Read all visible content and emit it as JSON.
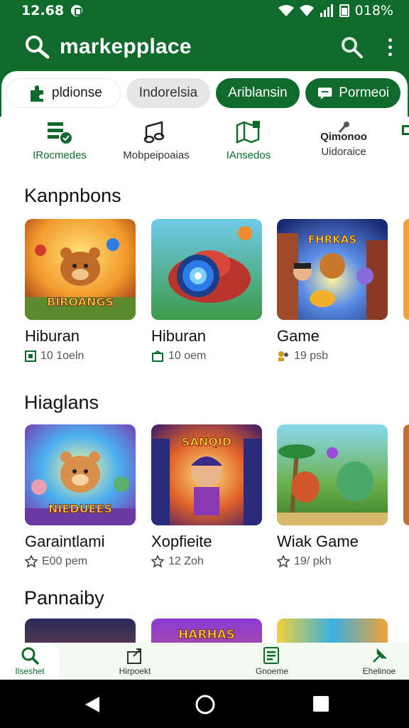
{
  "status_bar": {
    "time": "12.68",
    "battery": "018%"
  },
  "app_bar": {
    "title": "markepplace",
    "search_icon": "search-icon",
    "menu_icon": "more-vert-icon"
  },
  "chips": [
    {
      "label": "pldionse",
      "icon": "puzzle-icon"
    },
    {
      "label": "Indorelsia"
    },
    {
      "label": "Ariblansin"
    },
    {
      "label": "Pormeoi",
      "icon": "chat-icon"
    }
  ],
  "categories": [
    {
      "label": "IRocmedes",
      "icon": "list-icon"
    },
    {
      "label": "Mobpeipoaias",
      "icon": "music-icon"
    },
    {
      "label": "IAnsedos",
      "icon": "map-icon"
    },
    {
      "title": "Qimonoo",
      "label": "Uidoraice",
      "icon": "joystick-icon"
    }
  ],
  "sections": [
    {
      "title": "Kanpnbons",
      "items": [
        {
          "name": "Hiburan",
          "meta": "10 1oeln",
          "meta_icon": "download-icon",
          "art_text": "BIROANGS"
        },
        {
          "name": "Hiburan",
          "meta": "10 oem",
          "meta_icon": "star-outline-icon",
          "art_text": ""
        },
        {
          "name": "Game",
          "meta": "19 psb",
          "meta_icon": "people-icon",
          "art_text": "FHRKAS"
        }
      ]
    },
    {
      "title": "Hiaglans",
      "items": [
        {
          "name": "Garaintlami",
          "meta": "E00 pem",
          "meta_icon": "star-outline-icon",
          "art_text": "NIEDUEES"
        },
        {
          "name": "Xopfieite",
          "meta": "12 Zoh",
          "meta_icon": "star-outline-icon",
          "art_text": "SANQID"
        },
        {
          "name": "Wiak Game",
          "meta": "19/ pkh",
          "meta_icon": "star-outline-icon",
          "art_text": ""
        }
      ]
    },
    {
      "title": "Pannaiby",
      "items": [
        {
          "name": ""
        },
        {
          "name": ""
        },
        {
          "name": ""
        }
      ],
      "art_text": "HARHAS"
    }
  ],
  "bottom_nav": [
    {
      "label": "Ilseshet",
      "icon": "search-icon"
    },
    {
      "label": "Hirpoekt",
      "icon": "share-icon"
    },
    {
      "label": "Gnoeme",
      "icon": "list-icon"
    },
    {
      "label": "Ehelinoe",
      "icon": "pin-icon"
    }
  ],
  "colors": {
    "brand": "#0f6b2c",
    "chip_grey": "#e6e6e6",
    "nav_bg": "#f3f8f1"
  }
}
